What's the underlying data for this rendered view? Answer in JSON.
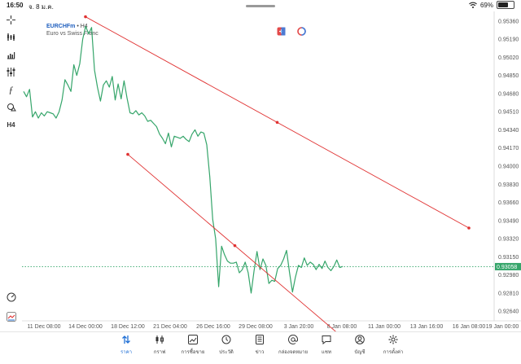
{
  "status_bar": {
    "time": "16:50",
    "date": "จ. 8 ม.ค.",
    "battery": "69%",
    "battery_level": 0.69
  },
  "chart": {
    "symbol": "EURCHFm",
    "separator": "•",
    "timeframe": "H4",
    "description": "Euro vs Swiss Franc",
    "current_price": "0.93058",
    "price_labels": [
      "0.95360",
      "0.95190",
      "0.95020",
      "0.94850",
      "0.94680",
      "0.94510",
      "0.94340",
      "0.94170",
      "0.94000",
      "0.93830",
      "0.93660",
      "0.93490",
      "0.93320",
      "0.93150",
      "0.92980",
      "0.92810",
      "0.92640"
    ],
    "date_labels": [
      "11 Dec 08:00",
      "14 Dec 00:00",
      "18 Dec 12:00",
      "21 Dec 04:00",
      "26 Dec 16:00",
      "29 Dec 08:00",
      "3 Jan 20:00",
      "8 Jan 08:00",
      "11 Jan 00:00",
      "13 Jan 16:00",
      "16 Jan 08:00",
      "19 Jan 00:00"
    ],
    "left_tool_label": "H4",
    "colors": {
      "line": "#35a56a",
      "trend": "#e03131",
      "price_box": "#35a56a",
      "accent": "#1f6fd6"
    }
  },
  "chart_data": {
    "type": "line",
    "title": "",
    "xlabel": "",
    "ylabel": "",
    "ylim": [
      0.9255,
      0.9545
    ],
    "x_axis": [
      "11 Dec 08:00",
      "14 Dec 00:00",
      "18 Dec 12:00",
      "21 Dec 04:00",
      "26 Dec 16:00",
      "29 Dec 08:00",
      "3 Jan 20:00",
      "8 Jan 08:00",
      "11 Jan 00:00",
      "13 Jan 16:00",
      "16 Jan 08:00",
      "19 Jan 00:00"
    ],
    "series": [
      {
        "values": [
          0.947,
          0.9465,
          0.9472,
          0.9446,
          0.9451,
          0.9445,
          0.945,
          0.9447,
          0.9451,
          0.945,
          0.9449,
          0.9445,
          0.9451,
          0.9462,
          0.9481,
          0.9476,
          0.947,
          0.9495,
          0.9485,
          0.9496,
          0.9519,
          0.9531,
          0.9524,
          0.953,
          0.949,
          0.9474,
          0.9461,
          0.9476,
          0.948,
          0.9474,
          0.9484,
          0.9462,
          0.9477,
          0.9463,
          0.948,
          0.9464,
          0.945,
          0.9449,
          0.9452,
          0.9448,
          0.945,
          0.9447,
          0.9442,
          0.9443,
          0.944,
          0.9437,
          0.943,
          0.9426,
          0.9421,
          0.9431,
          0.9418,
          0.9428,
          0.9427,
          0.9426,
          0.9428,
          0.9425,
          0.9423,
          0.943,
          0.9434,
          0.9428,
          0.9432,
          0.9431,
          0.942,
          0.939,
          0.935,
          0.9332,
          0.9287,
          0.9325,
          0.9317,
          0.9311,
          0.9309,
          0.9309,
          0.931,
          0.93,
          0.9303,
          0.931,
          0.93,
          0.9281,
          0.9302,
          0.932,
          0.9303,
          0.9313,
          0.9307,
          0.929,
          0.9293,
          0.9292,
          0.9304,
          0.9307,
          0.9313,
          0.9321,
          0.93,
          0.9282,
          0.9296,
          0.9307,
          0.9305,
          0.9314,
          0.9307,
          0.931,
          0.9308,
          0.9303,
          0.9308,
          0.9304,
          0.9311,
          0.9305,
          0.9302,
          0.9306,
          0.9312,
          0.9305,
          0.9306
        ]
      }
    ],
    "trendlines": [
      {
        "from": [
          "14 Dec 00:00",
          0.954
        ],
        "to": [
          "16 Jan 08:00",
          0.9342
        ]
      },
      {
        "from": [
          "18 Dec 12:00",
          0.9411
        ],
        "to": [
          "8 Jan 08:00",
          0.924
        ]
      }
    ],
    "grid": false,
    "legend": "none"
  },
  "bottom_nav": [
    {
      "label": "ราคา",
      "icon": "quotes-icon",
      "active": true
    },
    {
      "label": "กราฟ",
      "icon": "candles-icon",
      "active": false
    },
    {
      "label": "การซื้อขาย",
      "icon": "trade-icon",
      "active": false
    },
    {
      "label": "ประวัติ",
      "icon": "history-icon",
      "active": false
    },
    {
      "label": "ข่าว",
      "icon": "news-icon",
      "active": false
    },
    {
      "label": "กล่องจดหมาย",
      "icon": "mailbox-icon",
      "active": false
    },
    {
      "label": "แชท",
      "icon": "chat-icon",
      "active": false
    },
    {
      "label": "บัญชี",
      "icon": "account-icon",
      "active": false
    },
    {
      "label": "การตั้งค่า",
      "icon": "settings-icon",
      "active": false
    }
  ]
}
